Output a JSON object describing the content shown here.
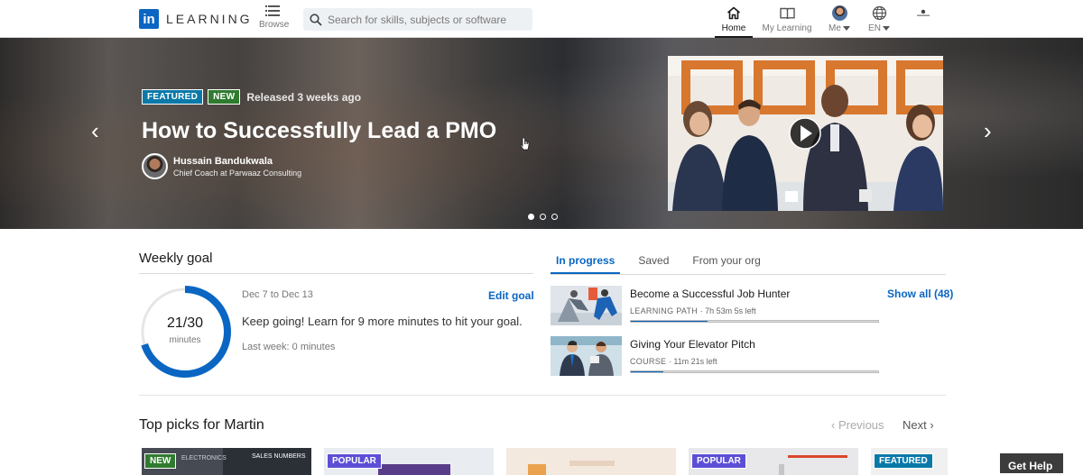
{
  "nav": {
    "logo_mark": "in",
    "logo_text": "LEARNING",
    "browse_label": "Browse",
    "search_placeholder": "Search for skills, subjects or software",
    "home_label": "Home",
    "my_learning_label": "My Learning",
    "me_label": "Me",
    "language_label": "EN"
  },
  "hero": {
    "badge_featured": "FEATURED",
    "badge_new": "NEW",
    "released": "Released 3 weeks ago",
    "title": "How to Successfully Lead a PMO",
    "author_name": "Hussain Bandukwala",
    "author_role": "Chief Coach at Parwaaz Consulting",
    "prev_arrow": "‹",
    "next_arrow": "›",
    "slide_count": 3,
    "active_slide": 1
  },
  "weekly_goal": {
    "title": "Weekly goal",
    "progress_text": "21/30",
    "unit": "minutes",
    "progress_fraction": 0.7,
    "dates": "Dec 7 to Dec 13",
    "edit_label": "Edit goal",
    "message": "Keep going! Learn for 9 more minutes to hit your goal.",
    "last_week": "Last week: 0 minutes"
  },
  "learning": {
    "tabs": [
      "In progress",
      "Saved",
      "From your org"
    ],
    "active_tab": 0,
    "show_all": "Show all (48)",
    "courses": [
      {
        "title": "Become a Successful Job Hunter",
        "type": "LEARNING PATH",
        "time": "7h 53m 5s left",
        "progress": 0.31
      },
      {
        "title": "Giving Your Elevator Pitch",
        "type": "COURSE",
        "time": "11m 21s left",
        "progress": 0.13
      }
    ]
  },
  "picks": {
    "title": "Top picks for Martin",
    "prev_label": "Previous",
    "next_label": "Next",
    "cards": [
      {
        "badge": "NEW",
        "caption": "ELECTRONICS",
        "caption2": "SALES NUMBERS"
      },
      {
        "badge": "POPULAR"
      },
      {
        "badge": ""
      },
      {
        "badge": "POPULAR"
      },
      {
        "badge": "FEATURED"
      }
    ]
  },
  "help": {
    "label": "Get Help"
  },
  "colors": {
    "brand": "#0a66c2",
    "featured": "#0a79a8",
    "new": "#2f7b2f",
    "popular": "#5c4fd6"
  }
}
